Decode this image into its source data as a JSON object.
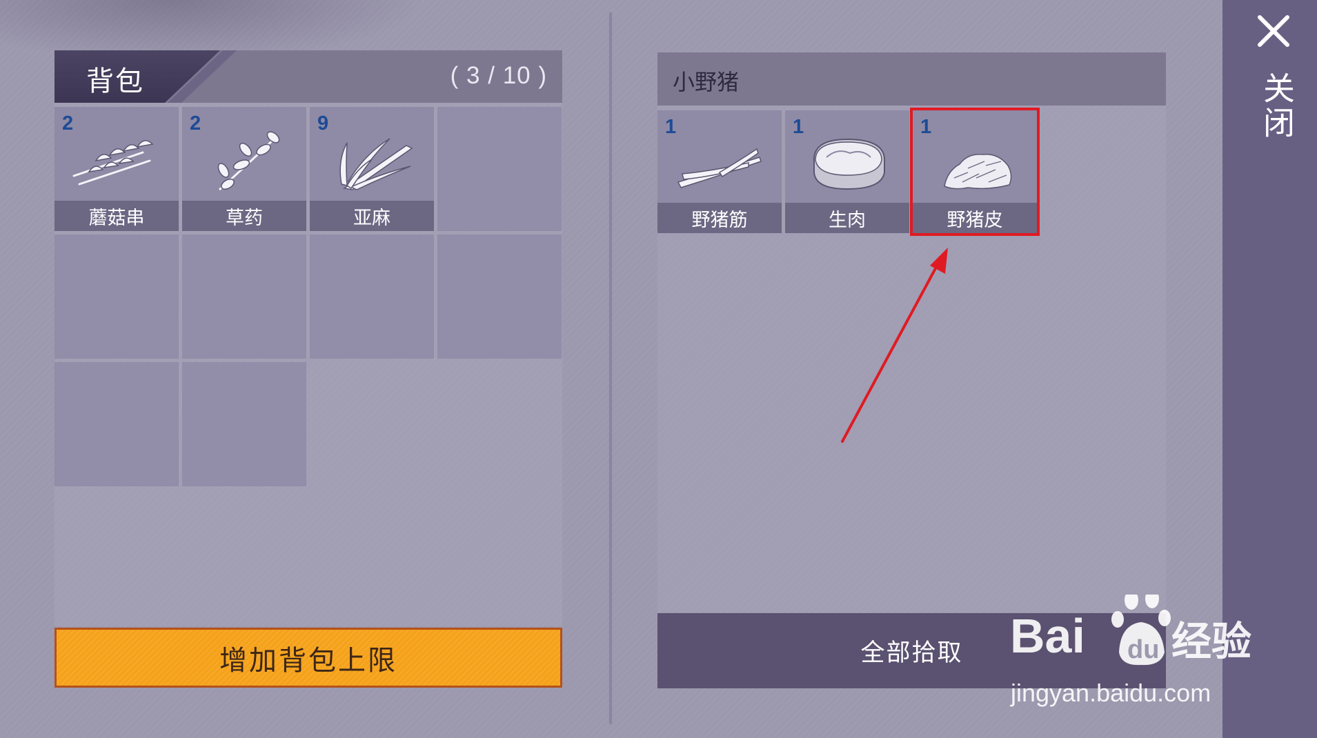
{
  "backpack": {
    "title": "背包",
    "capacity": "( 3 / 10 )",
    "items": [
      {
        "name": "蘑菇串",
        "count": "2",
        "icon": "mushroom-skewer-icon"
      },
      {
        "name": "草药",
        "count": "2",
        "icon": "herb-icon"
      },
      {
        "name": "亚麻",
        "count": "9",
        "icon": "flax-icon"
      }
    ],
    "empty_slots": 7,
    "expand_button_label": "增加背包上限"
  },
  "loot": {
    "title": "小野猪",
    "items": [
      {
        "name": "野猪筋",
        "count": "1",
        "icon": "boar-tendon-icon"
      },
      {
        "name": "生肉",
        "count": "1",
        "icon": "raw-meat-icon"
      },
      {
        "name": "野猪皮",
        "count": "1",
        "icon": "boar-hide-icon",
        "highlighted": true
      }
    ],
    "pickup_all_label": "全部拾取"
  },
  "close": {
    "label": "关闭",
    "icon": "close-icon"
  },
  "annotation": {
    "color": "#e01a22",
    "target": "野猪皮"
  },
  "watermark": {
    "brand": "Bai经验",
    "url": "jingyan.baidu.com"
  },
  "colors": {
    "accent_orange": "#f5a21a",
    "count_blue": "#1d4b96",
    "panel_purple": "#5b5170",
    "highlight_red": "#e01a22"
  }
}
